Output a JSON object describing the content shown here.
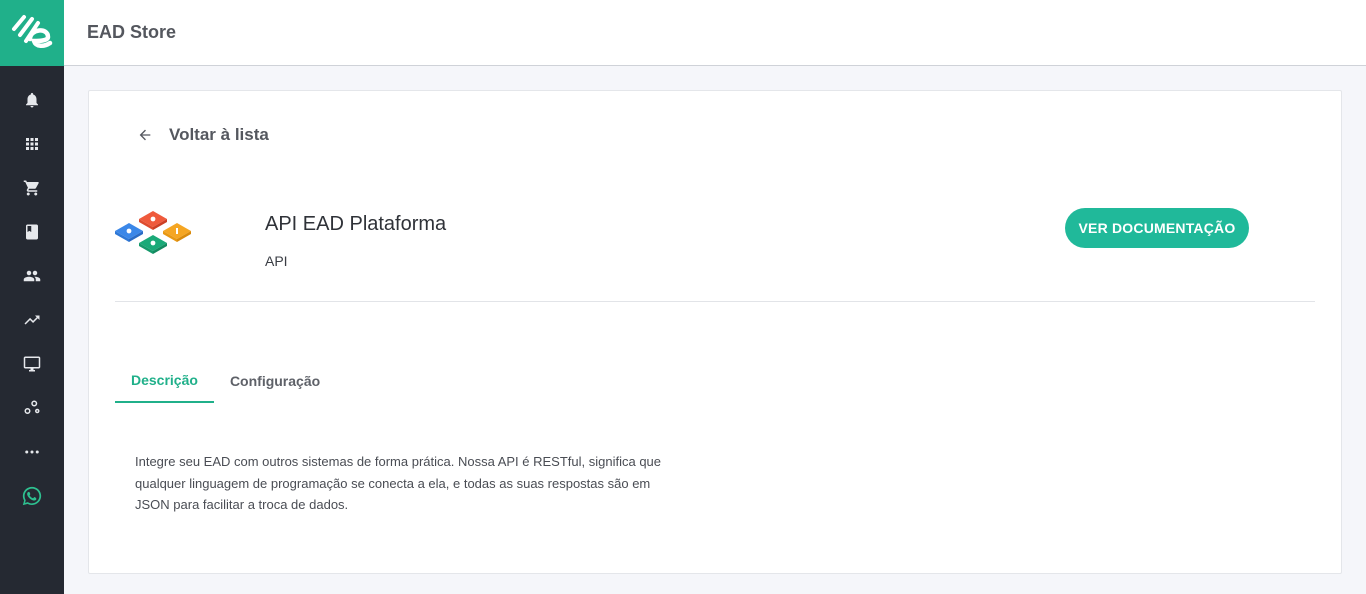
{
  "header": {
    "title": "EAD Store"
  },
  "sidebar": {
    "icons": [
      "bell-icon",
      "apps-grid-icon",
      "cart-icon",
      "book-icon",
      "users-icon",
      "trending-icon",
      "monitor-icon",
      "integrations-icon",
      "more-icon",
      "whatsapp-icon"
    ]
  },
  "page": {
    "back_label": "Voltar à lista",
    "app_title": "API EAD Plataforma",
    "app_subtitle": "API",
    "doc_button_label": "VER DOCUMENTAÇÃO",
    "tabs": [
      {
        "label": "Descrição",
        "active": true
      },
      {
        "label": "Configuração",
        "active": false
      }
    ],
    "description": "Integre seu EAD com outros sistemas de forma prática. Nossa API é RESTful, significa que qualquer linguagem de programação se conecta a ela, e todas as suas respostas são em JSON para facilitar a troca de dados."
  },
  "colors": {
    "accent": "#20b08a",
    "sidebar": "#252932",
    "whatsapp": "#2ec090"
  }
}
